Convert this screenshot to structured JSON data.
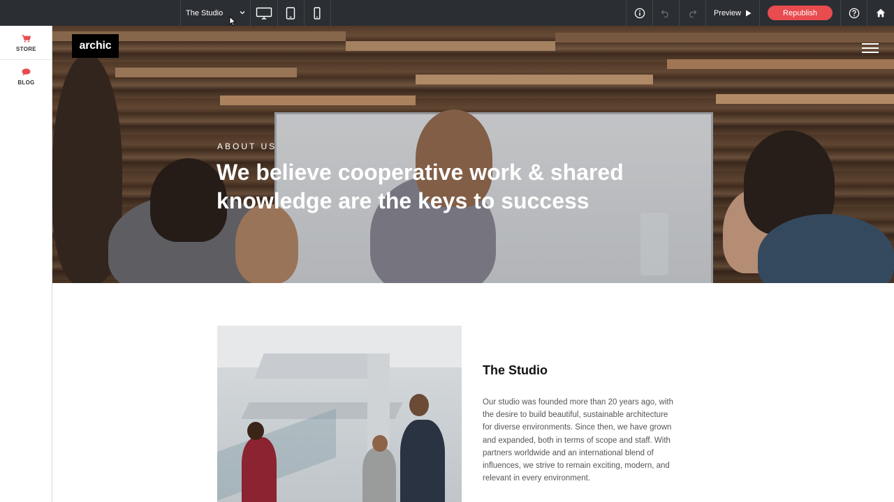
{
  "toolbar": {
    "page_selector": "The Studio",
    "preview_label": "Preview",
    "republish_label": "Republish"
  },
  "sidebar": {
    "items": [
      {
        "label": "STORE",
        "icon": "cart-icon"
      },
      {
        "label": "BLOG",
        "icon": "chat-bubble-icon"
      }
    ]
  },
  "hero": {
    "logo": "archic",
    "eyebrow": "ABOUT US",
    "headline": "We believe cooperative work & shared knowledge are the keys to success"
  },
  "section": {
    "title": "The Studio",
    "body": "Our studio was founded more than 20 years ago, with the desire to build beautiful, sustainable architecture for diverse environments. Since then, we have grown and expanded, both in terms of scope and staff. With partners worldwide and an international blend of influences, we strive to remain exciting, modern, and relevant in every environment."
  },
  "colors": {
    "toolbar_bg": "#2b2e33",
    "accent": "#e84c4f",
    "sidebar_icon": "#e84c4f"
  }
}
